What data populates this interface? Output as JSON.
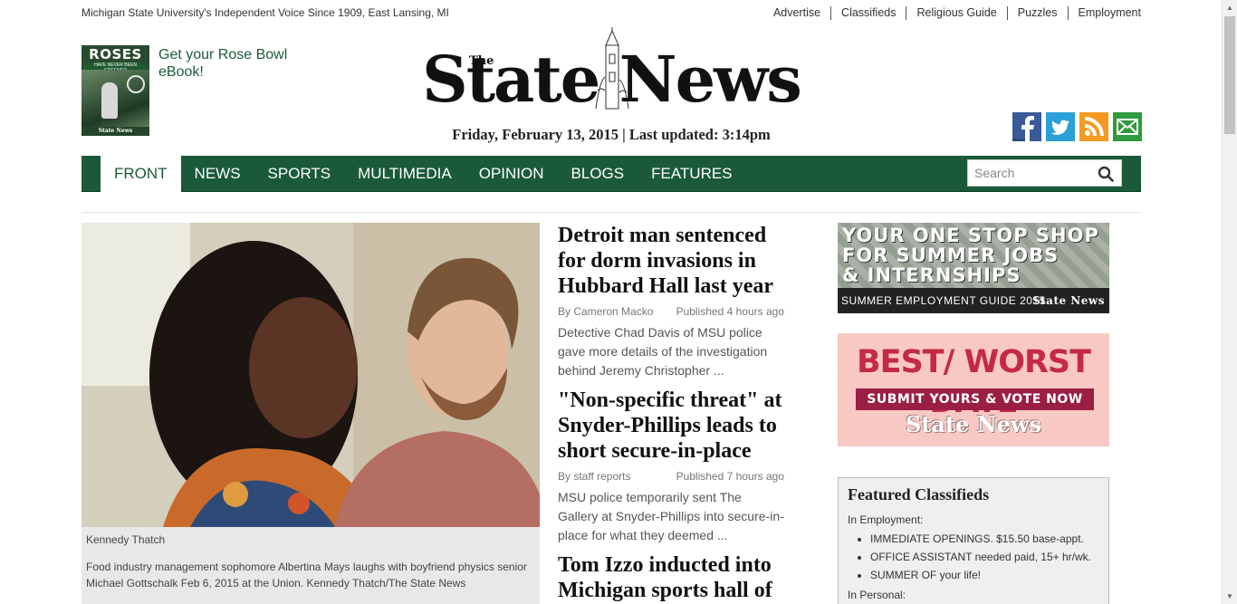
{
  "topbar": {
    "tagline": "Michigan State University's Independent Voice Since 1909, East Lansing, MI",
    "links": [
      "Advertise",
      "Classifieds",
      "Religious Guide",
      "Puzzles",
      "Employment"
    ]
  },
  "promo": {
    "cover_title": "ROSES",
    "cover_subtitle": "HAVE NEVER BEEN GREENER",
    "cover_footer": "State News",
    "text": "Get your Rose Bowl eBook!"
  },
  "masthead": {
    "the": "The",
    "title": "State News",
    "date": "Friday, February 13, 2015",
    "separator": "|",
    "updated": "Last updated: 3:14pm"
  },
  "social": [
    "facebook-icon",
    "twitter-icon",
    "rss-icon",
    "email-icon"
  ],
  "nav": {
    "items": [
      "FRONT",
      "NEWS",
      "SPORTS",
      "MULTIMEDIA",
      "OPINION",
      "BLOGS",
      "FEATURES"
    ],
    "active": "FRONT",
    "search_placeholder": "Search"
  },
  "lead": {
    "credit": "Kennedy Thatch",
    "caption": "Food industry management sophomore Albertina Mays laughs with boyfriend physics senior Michael Gottschalk Feb 6, 2015 at the Union. Kennedy Thatch/The State News"
  },
  "stories": [
    {
      "headline": "Detroit man sentenced for dorm invasions in Hubbard Hall last year",
      "byline": "By Cameron Macko",
      "published": "Published 4 hours ago",
      "summary": "Detective Chad Davis of MSU police gave more details of the investigation behind Jeremy Christopher ..."
    },
    {
      "headline": "\"Non-specific threat\" at Snyder-Phillips leads to short secure-in-place",
      "byline": "By staff reports",
      "published": "Published 7 hours ago",
      "summary": "MSU police temporarily sent The Gallery at Snyder-Phillips into secure-in-place for what they deemed ..."
    },
    {
      "headline": "Tom Izzo inducted into Michigan sports hall of fame",
      "byline": "",
      "published": "",
      "summary": ""
    }
  ],
  "ads": {
    "jobs": {
      "line1": "YOUR ONE STOP SHOP",
      "line2": "FOR SUMMER JOBS",
      "line3": "& INTERNSHIPS",
      "bar": "SUMMER EMPLOYMENT GUIDE 2015",
      "logo": "State News"
    },
    "date": {
      "title": "BEST/ WORST DATE",
      "button": "SUBMIT YOURS & VOTE NOW",
      "logo": "State News"
    }
  },
  "classifieds": {
    "title": "Featured Classifieds",
    "category1": "In Employment:",
    "items": [
      "IMMEDIATE OPENINGS. $15.50 base-appt.",
      "OFFICE ASSISTANT needed paid, 15+ hr/wk.",
      "SUMMER OF your life!"
    ],
    "category2": "In Personal:"
  },
  "colors": {
    "nav_green": "#1a5a3a",
    "promo_text": "#1d5a3a",
    "facebook": "#3b5a9a",
    "twitter": "#2a9fd8",
    "rss": "#f29a22",
    "email": "#2f9a3e",
    "date_ad_bg": "#f8c9c4",
    "date_ad_red": "#c52a44"
  }
}
